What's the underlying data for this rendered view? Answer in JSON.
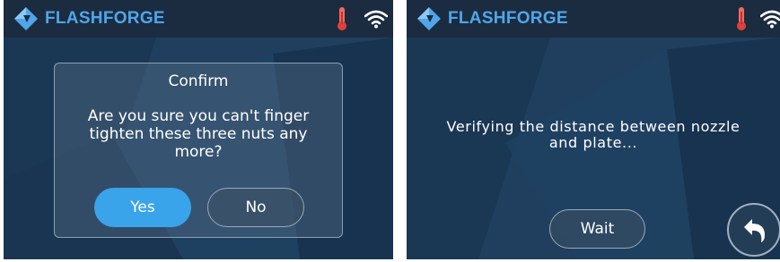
{
  "brand": {
    "name": "FLASHFORGE",
    "logo_color": "#4fa6ea"
  },
  "icons": {
    "temperature": "thermometer-icon",
    "network": "wifi-icon",
    "back": "back-arrow-icon"
  },
  "colors": {
    "background": "#1c3b58",
    "header": "#1b2c40",
    "primary_button": "#3aa4ea",
    "thermometer": "#e0413d"
  },
  "left_screen": {
    "dialog": {
      "title": "Confirm",
      "message": "Are you sure you can't finger tighten these three nuts any more?",
      "yes_label": "Yes",
      "no_label": "No"
    }
  },
  "right_screen": {
    "status_message": "Verifying the distance between nozzle and plate...",
    "wait_label": "Wait"
  }
}
